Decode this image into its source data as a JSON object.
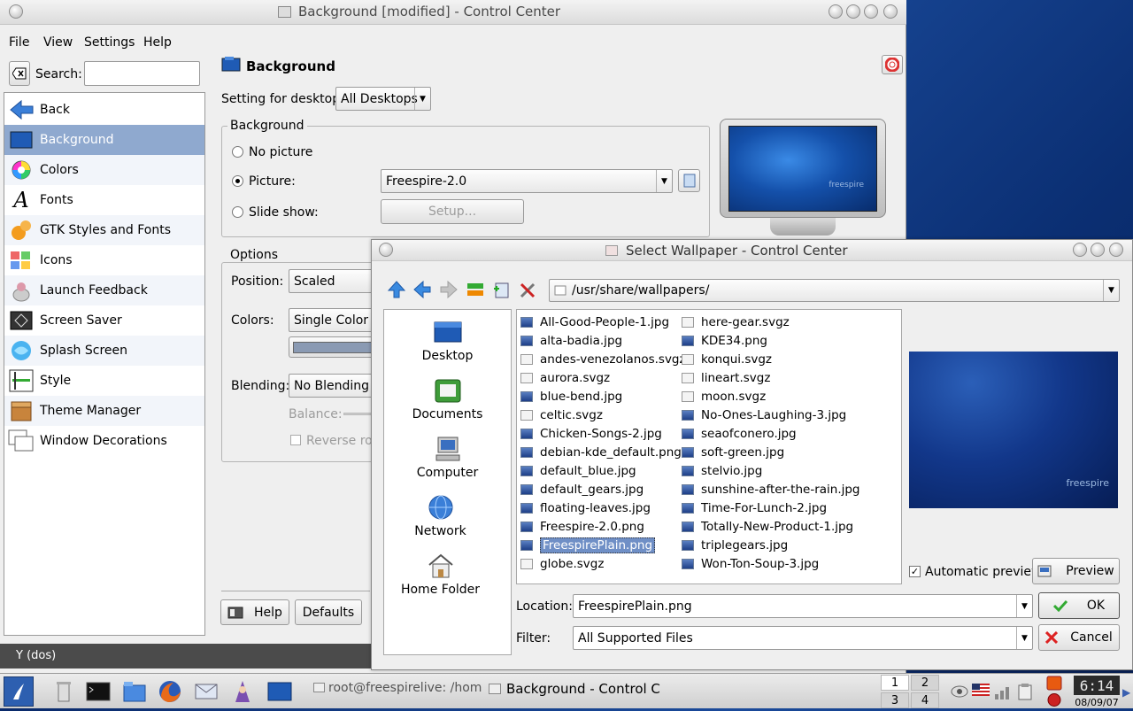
{
  "main_window": {
    "title": "Background [modified] - Control Center",
    "menu": [
      "File",
      "View",
      "Settings",
      "Help"
    ],
    "search_label": "Search:",
    "search_value": "",
    "sidebar": [
      {
        "label": "Back",
        "icon": "back-arrow-icon"
      },
      {
        "label": "Background",
        "icon": "background-icon"
      },
      {
        "label": "Colors",
        "icon": "colors-icon"
      },
      {
        "label": "Fonts",
        "icon": "fonts-icon"
      },
      {
        "label": "GTK Styles and Fonts",
        "icon": "gtk-icon"
      },
      {
        "label": "Icons",
        "icon": "icons-icon"
      },
      {
        "label": "Launch Feedback",
        "icon": "launch-feedback-icon"
      },
      {
        "label": "Screen Saver",
        "icon": "screensaver-icon"
      },
      {
        "label": "Splash Screen",
        "icon": "splash-icon"
      },
      {
        "label": "Style",
        "icon": "style-icon"
      },
      {
        "label": "Theme Manager",
        "icon": "theme-manager-icon"
      },
      {
        "label": "Window Decorations",
        "icon": "window-decorations-icon"
      }
    ],
    "page_title": "Background",
    "setting_for_desktop_label": "Setting for desktop:",
    "desktop_select": "All Desktops",
    "background_group": "Background",
    "no_picture": "No picture",
    "picture": "Picture:",
    "slide_show": "Slide show:",
    "picture_select": "Freespire-2.0",
    "setup_button": "Setup...",
    "monitor_text": "freespire",
    "options_group": "Options",
    "position_label": "Position:",
    "position_value": "Scaled",
    "colors_label": "Colors:",
    "colors_value": "Single Color",
    "blending_label": "Blending:",
    "blending_value": "No Blending",
    "balance_label": "Balance:",
    "reverse_label": "Reverse ro",
    "help_button": "Help",
    "defaults_button": "Defaults",
    "status_text": "Y (dos)"
  },
  "dialog": {
    "title": "Select Wallpaper - Control Center",
    "path": "/usr/share/wallpapers/",
    "places": [
      "Desktop",
      "Documents",
      "Computer",
      "Network",
      "Home Folder"
    ],
    "files_col1": [
      "All-Good-People-1.jpg",
      "alta-badia.jpg",
      "andes-venezolanos.svgz",
      "aurora.svgz",
      "blue-bend.jpg",
      "celtic.svgz",
      "Chicken-Songs-2.jpg",
      "debian-kde_default.png",
      "default_blue.jpg",
      "default_gears.jpg",
      "floating-leaves.jpg",
      "Freespire-2.0.png",
      "FreespirePlain.png",
      "globe.svgz"
    ],
    "files_col2": [
      "here-gear.svgz",
      "KDE34.png",
      "konqui.svgz",
      "lineart.svgz",
      "moon.svgz",
      "No-Ones-Laughing-3.jpg",
      "seaofconero.jpg",
      "soft-green.jpg",
      "stelvio.jpg",
      "sunshine-after-the-rain.jpg",
      "Time-For-Lunch-2.jpg",
      "Totally-New-Product-1.jpg",
      "triplegears.jpg",
      "Won-Ton-Soup-3.jpg"
    ],
    "selected_file": "FreespirePlain.png",
    "preview_text": "freespire",
    "automatic_preview": "Automatic preview",
    "preview_button": "Preview",
    "location_label": "Location:",
    "location_value": "FreespirePlain.png",
    "filter_label": "Filter:",
    "filter_value": "All Supported Files",
    "ok_button": "OK",
    "cancel_button": "Cancel"
  },
  "taskbar": {
    "task1": "root@freespirelive: /home/f",
    "task2": "Background - Control C",
    "pager": [
      "1",
      "2",
      "3",
      "4"
    ],
    "clock": "6:14",
    "date": "08/09/07"
  }
}
